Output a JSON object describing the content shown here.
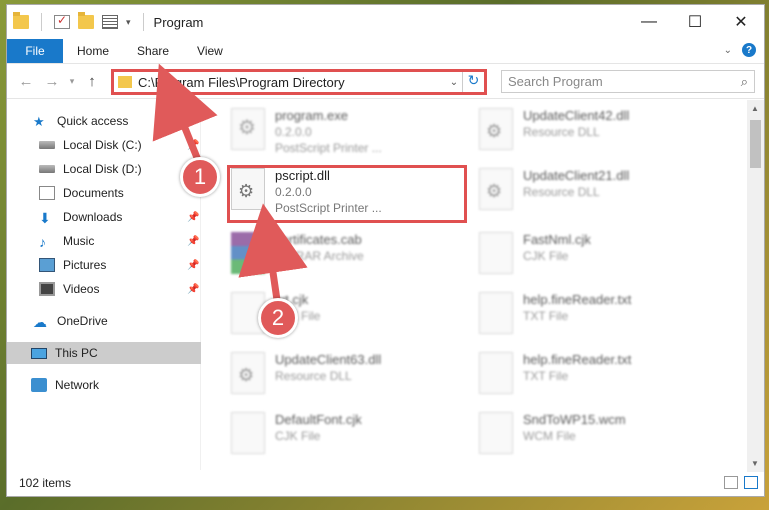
{
  "window": {
    "title": "Program"
  },
  "ribbon": {
    "tabs": [
      "File",
      "Home",
      "Share",
      "View"
    ]
  },
  "address": {
    "path": "C:\\Program Files\\Program Directory"
  },
  "search": {
    "placeholder": "Search Program"
  },
  "nav": {
    "items": [
      {
        "label": "Quick access",
        "icon": "star-icon"
      },
      {
        "label": "Local Disk (C:)",
        "icon": "disk-icon"
      },
      {
        "label": "Local Disk (D:)",
        "icon": "disk-icon"
      },
      {
        "label": "Documents",
        "icon": "documents-icon"
      },
      {
        "label": "Downloads",
        "icon": "download-icon"
      },
      {
        "label": "Music",
        "icon": "music-icon"
      },
      {
        "label": "Pictures",
        "icon": "pictures-icon"
      },
      {
        "label": "Videos",
        "icon": "videos-icon"
      },
      {
        "label": "OneDrive",
        "icon": "cloud-icon"
      },
      {
        "label": "This PC",
        "icon": "computer-icon"
      },
      {
        "label": "Network",
        "icon": "network-icon"
      }
    ]
  },
  "files": [
    {
      "name": "program.exe",
      "line2": "0.2.0.0",
      "line3": "PostScript Printer ..."
    },
    {
      "name": "pscript.dll",
      "line2": "0.2.0.0",
      "line3": "PostScript Printer ..."
    },
    {
      "name": "certificates.cab",
      "line2": "WinRAR Archive"
    },
    {
      "name": "txt.cjk",
      "line2": "CJK File"
    },
    {
      "name": "UpdateClient63.dll",
      "line2": "Resource DLL"
    },
    {
      "name": "DefaultFont.cjk",
      "line2": "CJK File"
    },
    {
      "name": "UpdateClient42.dll",
      "line2": "Resource DLL"
    },
    {
      "name": "UpdateClient21.dll",
      "line2": "Resource DLL"
    },
    {
      "name": "FastNml.cjk",
      "line2": "CJK File"
    },
    {
      "name": "help.fineReader.txt",
      "line2": "TXT File"
    },
    {
      "name": "help.fineReader.txt",
      "line2": "TXT File"
    },
    {
      "name": "SndToWP15.wcm",
      "line2": "WCM File"
    }
  ],
  "status": {
    "items": "102 items"
  },
  "callouts": {
    "one": "1",
    "two": "2"
  },
  "colors": {
    "accent": "#1979ca",
    "highlight": "#e05050"
  }
}
